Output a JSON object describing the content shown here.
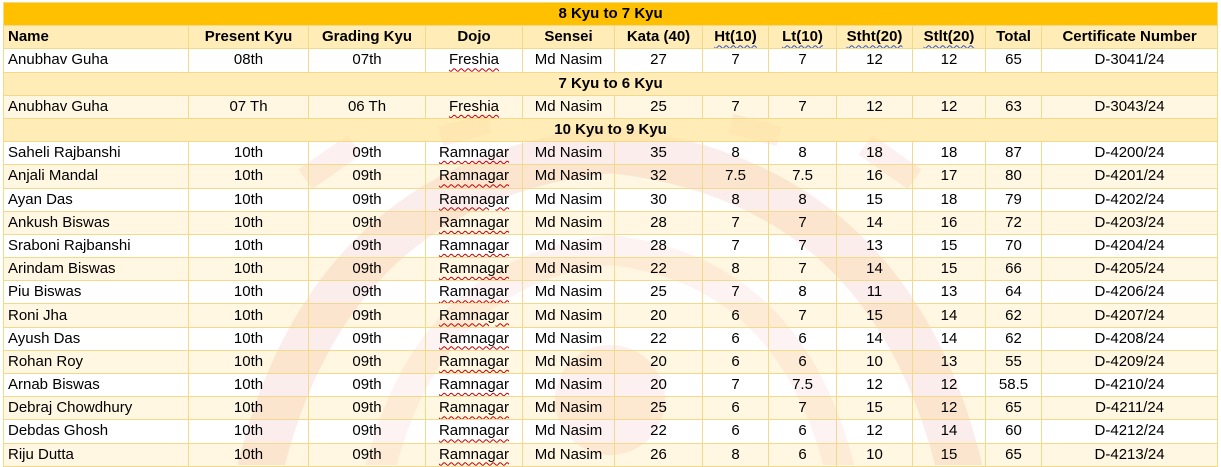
{
  "columns": [
    "Name",
    "Present Kyu",
    "Grading Kyu",
    "Dojo",
    "Sensei",
    "Kata (40)",
    "Ht(10)",
    "Lt(10)",
    "Stht(20)",
    "Stlt(20)",
    "Total",
    "Certificate Number"
  ],
  "sections": [
    {
      "title": "8 Kyu to 7 Kyu",
      "rows": [
        [
          "Anubhav Guha",
          "08th",
          "07th",
          "Freshia",
          "Md Nasim",
          "27",
          "7",
          "7",
          "12",
          "12",
          "65",
          "D-3041/24"
        ]
      ]
    },
    {
      "title": "7 Kyu to 6 Kyu",
      "rows": [
        [
          "Anubhav Guha",
          "07 Th",
          "06 Th",
          "Freshia",
          "Md Nasim",
          "25",
          "7",
          "7",
          "12",
          "12",
          "63",
          "D-3043/24"
        ]
      ]
    },
    {
      "title": "10 Kyu to 9 Kyu",
      "rows": [
        [
          "Saheli Rajbanshi",
          "10th",
          "09th",
          "Ramnagar",
          "Md Nasim",
          "35",
          "8",
          "8",
          "18",
          "18",
          "87",
          "D-4200/24"
        ],
        [
          "Anjali Mandal",
          "10th",
          "09th",
          "Ramnagar",
          "Md Nasim",
          "32",
          "7.5",
          "7.5",
          "16",
          "17",
          "80",
          "D-4201/24"
        ],
        [
          "Ayan Das",
          "10th",
          "09th",
          "Ramnagar",
          "Md Nasim",
          "30",
          "8",
          "8",
          "15",
          "18",
          "79",
          "D-4202/24"
        ],
        [
          "Ankush Biswas",
          "10th",
          "09th",
          "Ramnagar",
          "Md Nasim",
          "28",
          "7",
          "7",
          "14",
          "16",
          "72",
          "D-4203/24"
        ],
        [
          "Sraboni Rajbanshi",
          "10th",
          "09th",
          "Ramnagar",
          "Md Nasim",
          "28",
          "7",
          "7",
          "13",
          "15",
          "70",
          "D-4204/24"
        ],
        [
          "Arindam Biswas",
          "10th",
          "09th",
          "Ramnagar",
          "Md Nasim",
          "22",
          "8",
          "7",
          "14",
          "15",
          "66",
          "D-4205/24"
        ],
        [
          "Piu Biswas",
          "10th",
          "09th",
          "Ramnagar",
          "Md Nasim",
          "25",
          "7",
          "8",
          "11",
          "13",
          "64",
          "D-4206/24"
        ],
        [
          "Roni Jha",
          "10th",
          "09th",
          "Ramnagar",
          "Md Nasim",
          "20",
          "6",
          "7",
          "15",
          "14",
          "62",
          "D-4207/24"
        ],
        [
          "Ayush Das",
          "10th",
          "09th",
          "Ramnagar",
          "Md Nasim",
          "22",
          "6",
          "6",
          "14",
          "14",
          "62",
          "D-4208/24"
        ],
        [
          "Rohan Roy",
          "10th",
          "09th",
          "Ramnagar",
          "Md Nasim",
          "20",
          "6",
          "6",
          "10",
          "13",
          "55",
          "D-4209/24"
        ],
        [
          "Arnab Biswas",
          "10th",
          "09th",
          "Ramnagar",
          "Md Nasim",
          "20",
          "7",
          "7.5",
          "12",
          "12",
          "58.5",
          "D-4210/24"
        ],
        [
          "Debraj Chowdhury",
          "10th",
          "09th",
          "Ramnagar",
          "Md Nasim",
          "25",
          "6",
          "7",
          "15",
          "12",
          "65",
          "D-4211/24"
        ],
        [
          "Debdas Ghosh",
          "10th",
          "09th",
          "Ramnagar",
          "Md Nasim",
          "22",
          "6",
          "6",
          "12",
          "14",
          "60",
          "D-4212/24"
        ],
        [
          "Riju Dutta",
          "10th",
          "09th",
          "Ramnagar",
          "Md Nasim",
          "26",
          "8",
          "6",
          "10",
          "15",
          "65",
          "D-4213/24"
        ]
      ]
    }
  ],
  "colors": {
    "section_header_bg": "#ffc000",
    "band_bg": "#ffe9aa",
    "grid_line": "#f3d98a",
    "watermark": "#f4b6b6",
    "spell_underline": "#c00000"
  },
  "icons": {
    "watermark": "karate-emblem-watermark"
  }
}
